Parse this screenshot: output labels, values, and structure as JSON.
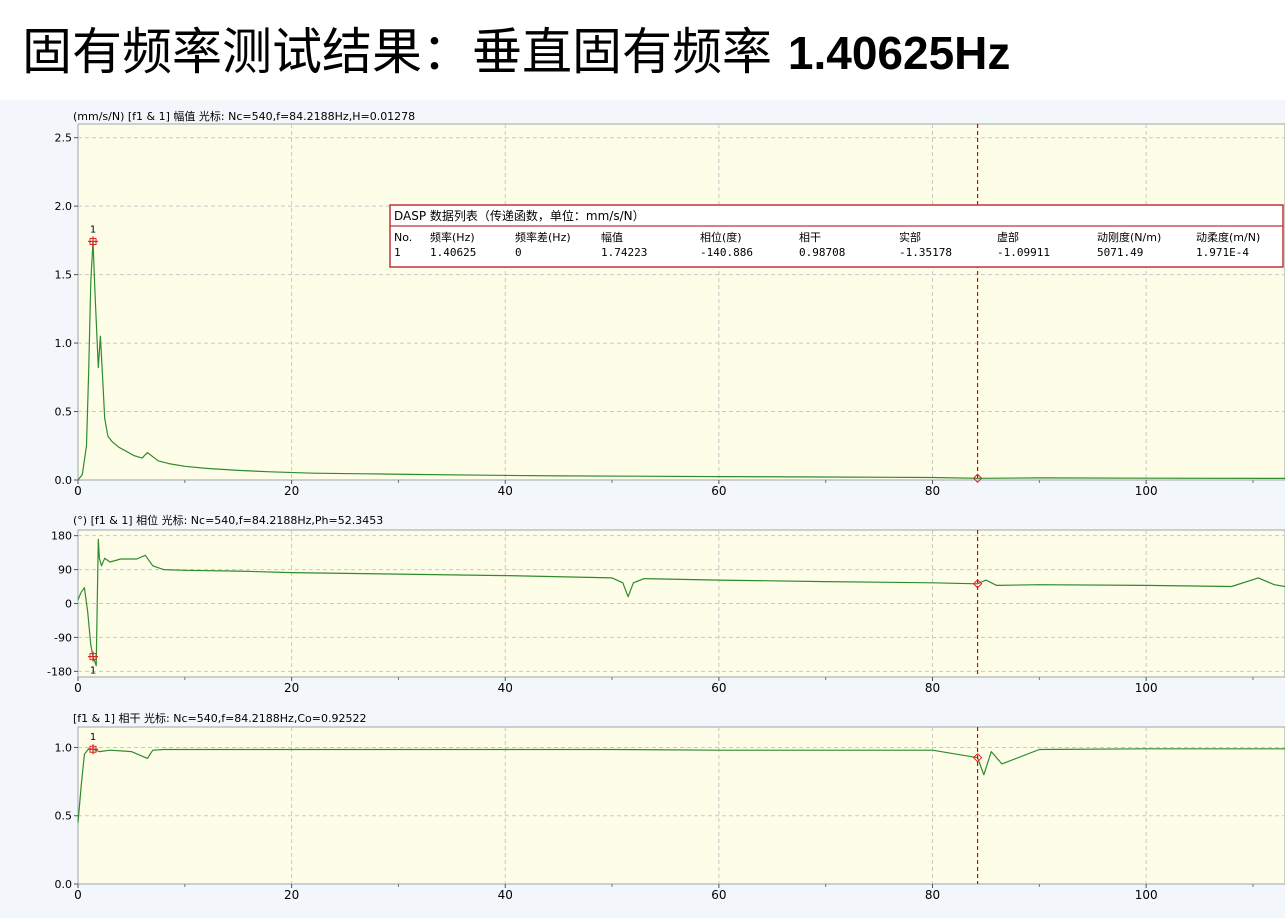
{
  "slide": {
    "title": "固有频率测试结果：垂直固有频率",
    "freq_value": "1.40625Hz"
  },
  "colors": {
    "plot_bg": "#fefee8",
    "panel_bg": "#f3f7fb",
    "trace": "#2e8b2e",
    "cursor": "#dd0000",
    "marker": "#dd2222",
    "grid": "#c8c8c8",
    "table_border": "#c0353a"
  },
  "cursor": {
    "x": 84.2188
  },
  "panels": [
    {
      "id": "amplitude",
      "header": "(mm/s/N)  [f1 & 1]  幅值  光标: Nc=540,f=84.2188Hz,H=0.01278",
      "y_ticks": [
        "2.5",
        "2.0",
        "1.5",
        "1.0",
        "0.5",
        "0.0"
      ],
      "y_tick_values": [
        2.5,
        2.0,
        1.5,
        1.0,
        0.5,
        0.0
      ],
      "ylim": [
        0,
        2.6
      ],
      "peak_marker_label": "1"
    },
    {
      "id": "phase",
      "header": "(°)  [f1 & 1]  相位  光标: Nc=540,f=84.2188Hz,Ph=52.3453",
      "y_ticks": [
        "180",
        "90",
        "0",
        "-90",
        "-180"
      ],
      "y_tick_values": [
        180,
        90,
        0,
        -90,
        -180
      ],
      "ylim": [
        -195,
        195
      ],
      "peak_marker_label": "1"
    },
    {
      "id": "coherence",
      "header": "[f1 & 1]  相干  光标: Nc=540,f=84.2188Hz,Co=0.92522",
      "y_ticks": [
        "1.0",
        "0.5",
        "0.0"
      ],
      "y_tick_values": [
        1.0,
        0.5,
        0.0
      ],
      "ylim": [
        0,
        1.15
      ],
      "peak_marker_label": "1"
    }
  ],
  "x_ticks": [
    "0",
    "20",
    "40",
    "60",
    "80",
    "100"
  ],
  "x_tick_values": [
    0,
    20,
    40,
    60,
    80,
    100
  ],
  "data_table": {
    "title": "DASP 数据列表（传递函数，单位：mm/s/N）",
    "headers": [
      "No.",
      "频率(Hz)",
      "频率差(Hz)",
      "幅值",
      "相位(度)",
      "相干",
      "实部",
      "虚部",
      "动刚度(N/m)",
      "动柔度(m/N)"
    ],
    "row": [
      "1",
      "1.40625",
      "0",
      "1.74223",
      "-140.886",
      "0.98708",
      "-1.35178",
      "-1.09911",
      "5071.49",
      "1.971E-4"
    ]
  },
  "chart_data": [
    {
      "type": "line",
      "title": "幅值",
      "ylabel": "(mm/s/N)",
      "xlim": [
        0,
        113
      ],
      "ylim": [
        0,
        2.6
      ],
      "grid": true,
      "series": [
        {
          "x": [
            0,
            0.4,
            0.8,
            1.0,
            1.2,
            1.40625,
            1.6,
            1.9,
            2.1,
            2.3,
            2.5,
            2.8,
            3.2,
            3.8,
            4.5,
            5.2,
            6.0,
            6.5,
            7.0,
            7.5,
            8.5,
            10,
            12,
            15,
            18,
            22,
            27,
            32,
            38,
            45,
            52,
            60,
            70,
            80,
            84.2188,
            90,
            100,
            113
          ],
          "y": [
            0,
            0.04,
            0.25,
            0.8,
            1.45,
            1.74223,
            1.35,
            0.82,
            1.05,
            0.75,
            0.45,
            0.32,
            0.28,
            0.24,
            0.21,
            0.18,
            0.16,
            0.2,
            0.17,
            0.14,
            0.12,
            0.1,
            0.085,
            0.07,
            0.06,
            0.05,
            0.045,
            0.04,
            0.035,
            0.03,
            0.028,
            0.025,
            0.022,
            0.018,
            0.01278,
            0.015,
            0.013,
            0.012
          ]
        }
      ]
    },
    {
      "type": "line",
      "title": "相位",
      "ylabel": "(°)",
      "xlim": [
        0,
        113
      ],
      "ylim": [
        -195,
        195
      ],
      "grid": true,
      "series": [
        {
          "x": [
            0,
            0.3,
            0.6,
            0.9,
            1.2,
            1.40625,
            1.7,
            1.9,
            2.0,
            2.2,
            2.5,
            3,
            4,
            5.5,
            6.3,
            7,
            8,
            10,
            15,
            20,
            30,
            40,
            50,
            51,
            51.5,
            52,
            53,
            60,
            70,
            80,
            84.2188,
            85,
            86,
            90,
            100,
            108,
            110.5,
            112,
            113
          ],
          "y": [
            10,
            30,
            42,
            -20,
            -110,
            -140.886,
            -165,
            170,
            120,
            100,
            120,
            110,
            118,
            118,
            128,
            100,
            90,
            88,
            86,
            82,
            78,
            74,
            68,
            55,
            18,
            55,
            66,
            62,
            58,
            55,
            52.3453,
            62,
            48,
            50,
            48,
            45,
            68,
            50,
            45
          ]
        }
      ]
    },
    {
      "type": "line",
      "title": "相干",
      "xlim": [
        0,
        113
      ],
      "ylim": [
        0,
        1.15
      ],
      "grid": true,
      "series": [
        {
          "x": [
            0,
            0.3,
            0.6,
            1.0,
            1.40625,
            2,
            3,
            5,
            6.5,
            7,
            8,
            12,
            20,
            30,
            40,
            50,
            60,
            70,
            80,
            84.2188,
            84.8,
            85.5,
            86.5,
            90,
            100,
            113
          ],
          "y": [
            0.45,
            0.72,
            0.95,
            0.99,
            0.98708,
            0.97,
            0.98,
            0.97,
            0.92,
            0.98,
            0.985,
            0.985,
            0.985,
            0.985,
            0.985,
            0.985,
            0.98,
            0.98,
            0.98,
            0.92522,
            0.8,
            0.97,
            0.88,
            0.985,
            0.99,
            0.99
          ]
        }
      ]
    }
  ]
}
